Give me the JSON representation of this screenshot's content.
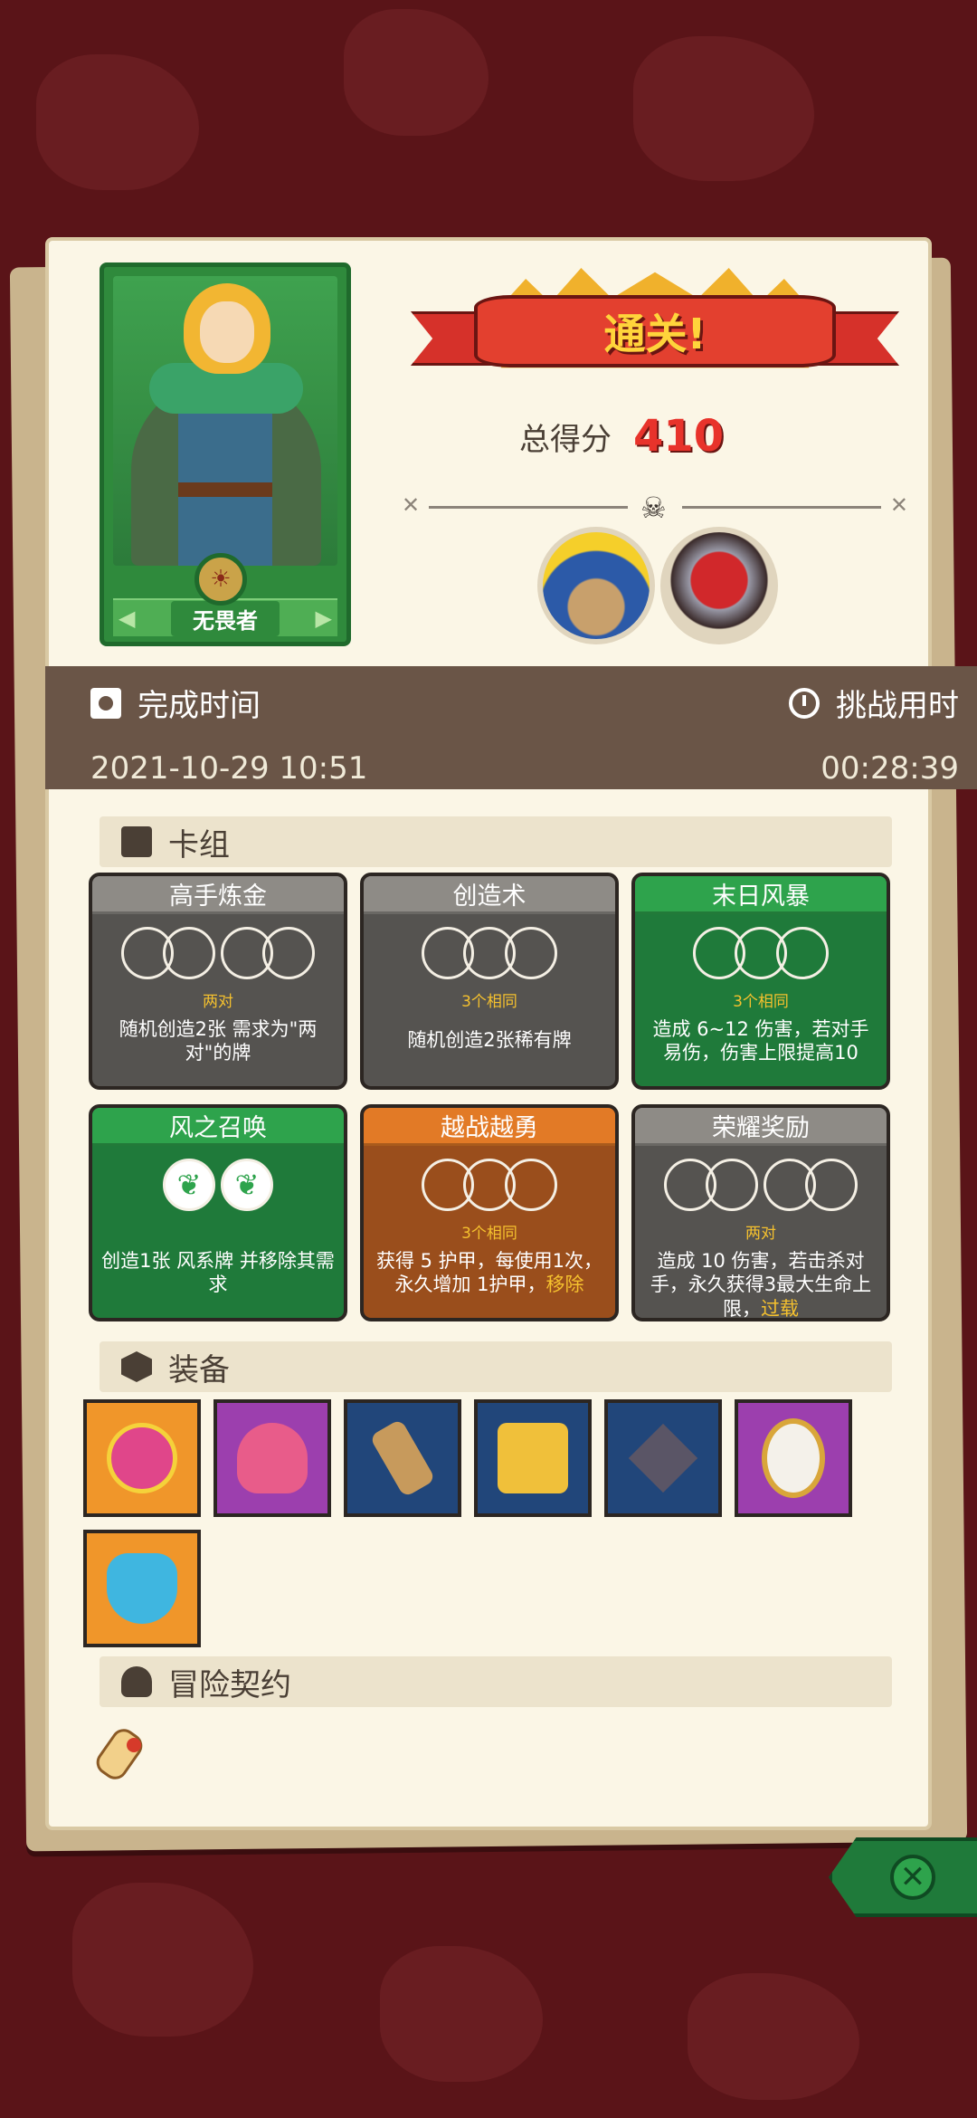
{
  "hero": {
    "name": "无畏者"
  },
  "result": {
    "banner": "通关!",
    "score_label": "总得分",
    "score_value": "410"
  },
  "stats": {
    "finish_label": "完成时间",
    "finish_value": "2021-10-29 10:51",
    "duration_label": "挑战用时",
    "duration_value": "00:28:39"
  },
  "sections": {
    "deck": "卡组",
    "equipment": "装备",
    "contract": "冒险契约"
  },
  "cards": [
    {
      "title": "高手炼金",
      "sub": "两对",
      "desc": "随机创造2张 需求为\"两对\"的牌",
      "color": "gray"
    },
    {
      "title": "创造术",
      "sub": "3个相同",
      "desc": "随机创造2张稀有牌",
      "color": "gray"
    },
    {
      "title": "末日风暴",
      "sub": "3个相同",
      "desc": "造成 6~12 伤害，若对手 易伤，伤害上限提高10",
      "color": "green"
    },
    {
      "title": "风之召唤",
      "sub": "",
      "desc": "创造1张 风系牌 并移除其需求",
      "color": "green"
    },
    {
      "title": "越战越勇",
      "sub": "3个相同",
      "desc_a": "获得 5 护甲，每使用1次，永久增加 1护甲，",
      "desc_hl": "移除",
      "color": "orange"
    },
    {
      "title": "荣耀奖励",
      "sub": "两对",
      "desc_a": "造成 10 伤害，若击杀对手，永久获得3最大生命上限，",
      "desc_hl": "过载",
      "color": "gray"
    }
  ],
  "equipment": [
    {
      "icon": "moon-orb-icon",
      "bg": "#f0962a"
    },
    {
      "icon": "mushroom-cap-icon",
      "bg": "#9c3fae"
    },
    {
      "icon": "horn-icon",
      "bg": "#21467a"
    },
    {
      "icon": "dice-box-icon",
      "bg": "#21467a"
    },
    {
      "icon": "dark-gem-icon",
      "bg": "#21467a"
    },
    {
      "icon": "mirror-icon",
      "bg": "#9c3fae"
    },
    {
      "icon": "ice-shield-icon",
      "bg": "#f0962a"
    }
  ],
  "colors": {
    "accent_red": "#e8332b",
    "panel_brown": "#6a5547",
    "card_green": "#1f7a3a",
    "card_orange": "#e27a26"
  }
}
